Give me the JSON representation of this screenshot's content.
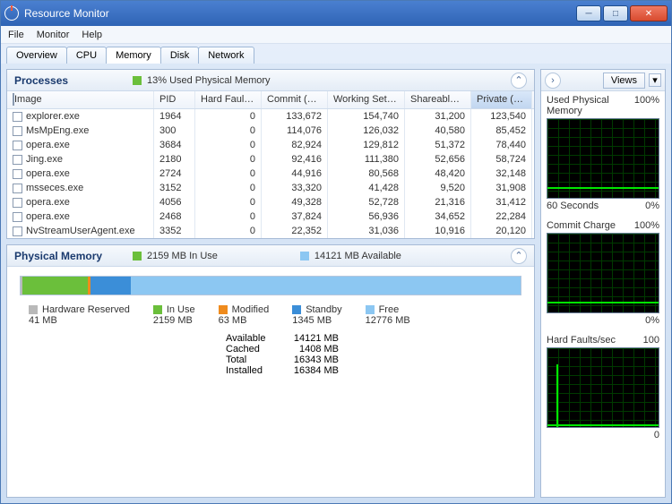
{
  "window": {
    "title": "Resource Monitor"
  },
  "menu": {
    "file": "File",
    "monitor": "Monitor",
    "help": "Help"
  },
  "tabs": {
    "overview": "Overview",
    "cpu": "CPU",
    "memory": "Memory",
    "disk": "Disk",
    "network": "Network"
  },
  "processes": {
    "title": "Processes",
    "sub": "13% Used Physical Memory",
    "headers": {
      "image": "Image",
      "pid": "PID",
      "hf": "Hard Faults/sec",
      "commit": "Commit (KB)",
      "ws": "Working Set (KB)",
      "share": "Shareable (KB)",
      "priv": "Private (KB)"
    },
    "rows": [
      {
        "image": "explorer.exe",
        "pid": "1964",
        "hf": "0",
        "commit": "133,672",
        "ws": "154,740",
        "share": "31,200",
        "priv": "123,540"
      },
      {
        "image": "MsMpEng.exe",
        "pid": "300",
        "hf": "0",
        "commit": "114,076",
        "ws": "126,032",
        "share": "40,580",
        "priv": "85,452"
      },
      {
        "image": "opera.exe",
        "pid": "3684",
        "hf": "0",
        "commit": "82,924",
        "ws": "129,812",
        "share": "51,372",
        "priv": "78,440"
      },
      {
        "image": "Jing.exe",
        "pid": "2180",
        "hf": "0",
        "commit": "92,416",
        "ws": "111,380",
        "share": "52,656",
        "priv": "58,724"
      },
      {
        "image": "opera.exe",
        "pid": "2724",
        "hf": "0",
        "commit": "44,916",
        "ws": "80,568",
        "share": "48,420",
        "priv": "32,148"
      },
      {
        "image": "msseces.exe",
        "pid": "3152",
        "hf": "0",
        "commit": "33,320",
        "ws": "41,428",
        "share": "9,520",
        "priv": "31,908"
      },
      {
        "image": "opera.exe",
        "pid": "4056",
        "hf": "0",
        "commit": "49,328",
        "ws": "52,728",
        "share": "21,316",
        "priv": "31,412"
      },
      {
        "image": "opera.exe",
        "pid": "2468",
        "hf": "0",
        "commit": "37,824",
        "ws": "56,936",
        "share": "34,652",
        "priv": "22,284"
      },
      {
        "image": "NvStreamUserAgent.exe",
        "pid": "3352",
        "hf": "0",
        "commit": "22,352",
        "ws": "31,036",
        "share": "10,916",
        "priv": "20,120"
      }
    ]
  },
  "physmem": {
    "title": "Physical Memory",
    "inuse_sub": "2159 MB In Use",
    "avail_sub": "14121 MB Available",
    "legend": {
      "hw": {
        "label": "Hardware Reserved",
        "val": "41 MB"
      },
      "inuse": {
        "label": "In Use",
        "val": "2159 MB"
      },
      "mod": {
        "label": "Modified",
        "val": "63 MB"
      },
      "standby": {
        "label": "Standby",
        "val": "1345 MB"
      },
      "free": {
        "label": "Free",
        "val": "12776 MB"
      }
    },
    "stats": {
      "available": {
        "lab": "Available",
        "val": "14121 MB"
      },
      "cached": {
        "lab": "Cached",
        "val": "1408 MB"
      },
      "total": {
        "lab": "Total",
        "val": "16343 MB"
      },
      "installed": {
        "lab": "Installed",
        "val": "16384 MB"
      }
    },
    "colors": {
      "hw": "#b9b9b9",
      "inuse": "#6bbf3b",
      "mod": "#ef8b1d",
      "standby": "#3b8ed8",
      "free": "#8cc7f2"
    }
  },
  "right": {
    "views": "Views",
    "chart1": {
      "title": "Used Physical Memory",
      "max": "100%",
      "bl": "60 Seconds",
      "br": "0%"
    },
    "chart2": {
      "title": "Commit Charge",
      "max": "100%",
      "br": "0%"
    },
    "chart3": {
      "title": "Hard Faults/sec",
      "max": "100",
      "br": "0"
    }
  }
}
